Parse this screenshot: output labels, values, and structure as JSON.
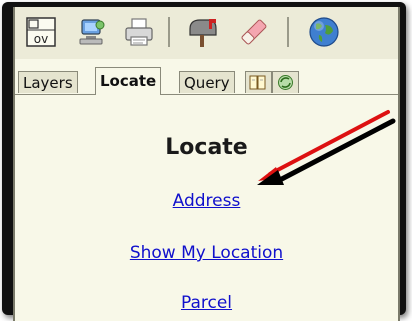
{
  "toolbar": {
    "icons": [
      "overview-map-icon",
      "identify-icon",
      "print-icon",
      "mailbox-icon",
      "eraser-icon",
      "globe-icon"
    ],
    "overview_label": "ov"
  },
  "tabs": {
    "layers": "Layers",
    "locate": "Locate",
    "query": "Query"
  },
  "locate": {
    "title": "Locate",
    "links": {
      "address": "Address",
      "show_my_location": "Show My Location",
      "parcel": "Parcel"
    }
  },
  "colors": {
    "panel_bg": "#f8f8e8",
    "link": "#1010cc",
    "arrow_red": "#dd1111",
    "arrow_black": "#000000"
  }
}
